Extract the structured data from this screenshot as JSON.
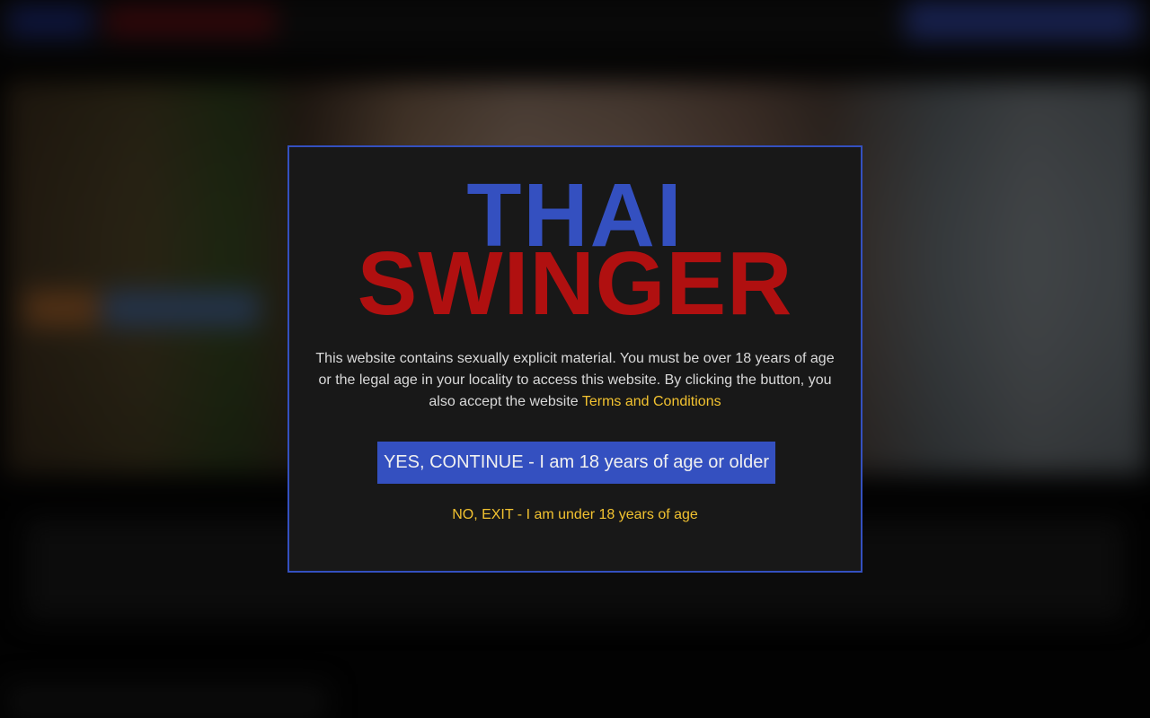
{
  "modal": {
    "logo": {
      "line1": "THAI",
      "line2": "SWINGER"
    },
    "notice_text": "This website contains sexually explicit material. You must be over 18 years of age or the legal age in your locality to access this website. By clicking the button, you also accept the website ",
    "terms_link": "Terms and Conditions",
    "yes_button": "YES, CONTINUE - I am 18 years of age or older",
    "no_link": "NO, EXIT - I am under 18 years of age"
  },
  "colors": {
    "brand_blue": "#3450c0",
    "brand_red": "#b01010",
    "link_yellow": "#f2c230",
    "modal_bg": "#181818"
  }
}
